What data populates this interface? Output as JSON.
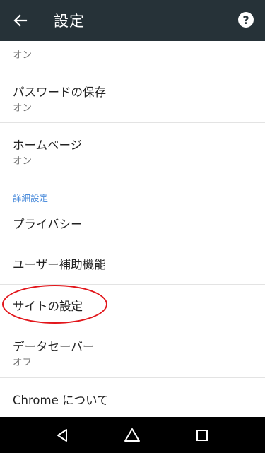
{
  "app_bar": {
    "title": "設定",
    "back_icon": "arrow-back-icon",
    "help_icon": "help-icon",
    "help_glyph": "?",
    "background": "#263238"
  },
  "settings": {
    "partial_item": {
      "summary": "オン"
    },
    "password_save": {
      "title": "パスワードの保存",
      "summary": "オン"
    },
    "home_page": {
      "title": "ホームページ",
      "summary": "オン"
    },
    "advanced_header": "詳細設定",
    "privacy": {
      "title": "プライバシー"
    },
    "accessibility": {
      "title": "ユーザー補助機能"
    },
    "site_settings": {
      "title": "サイトの設定"
    },
    "data_saver": {
      "title": "データセーバー",
      "summary": "オフ"
    },
    "about_chrome": {
      "title": "Chrome について"
    }
  },
  "annotation": {
    "highlight_color": "#e2161b"
  },
  "nav_bar": {
    "back_icon": "triangle-back-icon",
    "home_icon": "circle-home-icon",
    "recents_icon": "square-recents-icon"
  },
  "colors": {
    "accent": "#4a8bdb",
    "divider": "#e3e3e3",
    "summary_text": "#737373"
  }
}
